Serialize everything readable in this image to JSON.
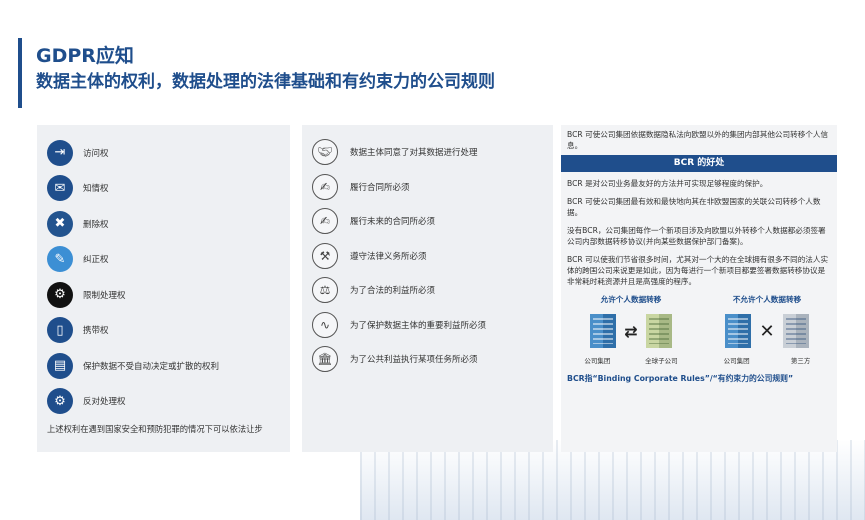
{
  "title": {
    "main": "GDPR应知",
    "sub": "数据主体的权利，数据处理的法律基础和有约束力的公司规则"
  },
  "rights": {
    "items": [
      {
        "label": "访问权",
        "icon": "door-exit-icon"
      },
      {
        "label": "知情权",
        "icon": "chat-bubble-icon"
      },
      {
        "label": "删除权",
        "icon": "delete-x-icon"
      },
      {
        "label": "纠正权",
        "icon": "document-edit-icon"
      },
      {
        "label": "限制处理权",
        "icon": "gear-restrict-icon"
      },
      {
        "label": "携带权",
        "icon": "mobile-transfer-icon"
      },
      {
        "label": "保护数据不受自动决定或扩散的权利",
        "icon": "id-card-icon"
      },
      {
        "label": "反对处理权",
        "icon": "gear-lock-icon"
      }
    ],
    "note": "上述权利在遇到国家安全和预防犯罪的情况下可以依法让步"
  },
  "legal_bases": {
    "items": [
      {
        "label": "数据主体同意了对其数据进行处理",
        "icon": "handshake-icon"
      },
      {
        "label": "履行合同所必须",
        "icon": "contract-icon"
      },
      {
        "label": "履行未来的合同所必须",
        "icon": "contract-future-icon"
      },
      {
        "label": "遵守法律义务所必须",
        "icon": "gavel-icon"
      },
      {
        "label": "为了合法的利益所必须",
        "icon": "scales-icon"
      },
      {
        "label": "为了保护数据主体的重要利益所必须",
        "icon": "pulse-icon"
      },
      {
        "label": "为了公共利益执行某项任务所必须",
        "icon": "government-building-icon"
      }
    ]
  },
  "bcr": {
    "intro": "BCR 可使公司集团依据数据隐私法向欧盟以外的集团内部其他公司转移个人信息。",
    "header": "BCR 的好处",
    "paras": [
      "BCR 是对公司业务最友好的方法并可实现足够程度的保护。",
      "BCR 可使公司集团最有效和最快地向其在非欧盟国家的关联公司转移个人数据。",
      "没有BCR，公司集团每作一个新项目涉及向欧盟以外转移个人数据都必须签署公司内部数据转移协议(并向某些数据保护部门备案)。",
      "BCR 可以使我们节省很多时间，尤其对一个大的在全球拥有很多不同的法人实体的跨国公司来说更是如此，因为每进行一个新项目都要签署数据转移协议是非常耗时耗资源并且是高强度的程序。"
    ],
    "allowed": {
      "title": "允许个人数据转移",
      "left_caption": "公司集团",
      "right_caption": "全球子公司"
    },
    "not_allowed": {
      "title": "不允许个人数据转移",
      "left_caption": "公司集团",
      "right_caption": "第三方"
    },
    "footer": "BCR指“Binding Corporate Rules”/“有约束力的公司规则”"
  }
}
